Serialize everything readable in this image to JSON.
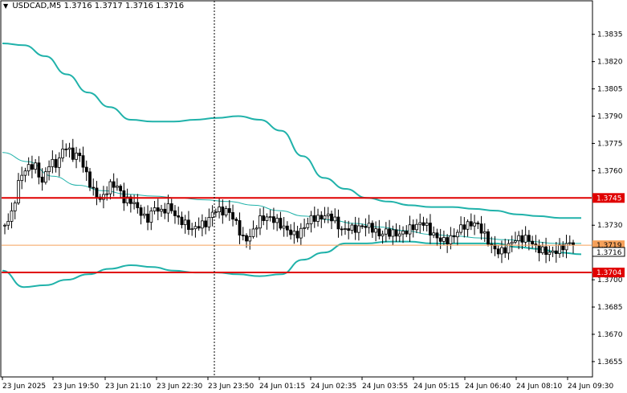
{
  "header": {
    "symbol": "USDCAD,M5",
    "open": "1.3716",
    "high": "1.3717",
    "low": "1.3716",
    "close": "1.3716"
  },
  "colors": {
    "background": "#ffffff",
    "candle": "#000000",
    "bands": "#20b2aa",
    "level": "#e00000",
    "current_price": "#f5a05a",
    "grid_vline": "#000000"
  },
  "chart_data": {
    "type": "candlestick",
    "symbol": "USDCAD",
    "timeframe": "M5",
    "ylim": [
      1.3647,
      1.3853
    ],
    "y_ticks": [
      "1.3835",
      "1.3820",
      "1.3805",
      "1.3790",
      "1.3775",
      "1.3760",
      "1.3745",
      "1.3730",
      "1.3719",
      "1.3716",
      "1.3704",
      "1.3700",
      "1.3685",
      "1.3670",
      "1.3655"
    ],
    "y_tick_values": [
      1.3835,
      1.382,
      1.3805,
      1.379,
      1.3775,
      1.376,
      1.373,
      1.37,
      1.3685,
      1.367,
      1.3655
    ],
    "x_labels": [
      "23 Jun 2025",
      "23 Jun 19:50",
      "23 Jun 21:10",
      "23 Jun 22:30",
      "23 Jun 23:50",
      "24 Jun 01:15",
      "24 Jun 02:35",
      "24 Jun 03:55",
      "24 Jun 05:15",
      "24 Jun 06:40",
      "24 Jun 08:10",
      "24 Jun 09:30"
    ],
    "levels": [
      {
        "price": 1.3745,
        "label": "1.3745"
      },
      {
        "price": 1.3704,
        "label": "1.3704"
      }
    ],
    "current_price": {
      "price": 1.3716,
      "label": "1.3716"
    },
    "marker_price": {
      "price": 1.3719,
      "label": "1.3719"
    },
    "close_path": [
      1.373,
      1.3733,
      1.3752,
      1.376,
      1.3766,
      1.3758,
      1.3768,
      1.3762,
      1.377,
      1.3764,
      1.3768,
      1.376,
      1.3752,
      1.3746,
      1.375,
      1.3747,
      1.374,
      1.3744,
      1.3742,
      1.3737,
      1.3741,
      1.3734,
      1.3736,
      1.3731,
      1.3733,
      1.3732,
      1.3734,
      1.3731,
      1.3735,
      1.3733,
      1.3736,
      1.3733,
      1.3726,
      1.3728,
      1.3732,
      1.373,
      1.3729,
      1.3729,
      1.373,
      1.3729,
      1.3731,
      1.3732,
      1.3729,
      1.3732,
      1.3734,
      1.3731,
      1.3733,
      1.3729,
      1.3727,
      1.3724,
      1.3722,
      1.3728,
      1.373,
      1.3729,
      1.3728,
      1.3726,
      1.3727,
      1.3724,
      1.3725,
      1.3726,
      1.3727,
      1.3728,
      1.3726,
      1.3727,
      1.3725,
      1.3722,
      1.372,
      1.3719,
      1.372,
      1.3718,
      1.3719,
      1.3718,
      1.372,
      1.3719,
      1.3718,
      1.3716,
      1.3716
    ],
    "upper_band": [
      1.383,
      1.3829,
      1.3823,
      1.3813,
      1.3803,
      1.3795,
      1.3788,
      1.3787,
      1.3787,
      1.3788,
      1.3789,
      1.379,
      1.3788,
      1.3782,
      1.3768,
      1.3756,
      1.375,
      1.3745,
      1.3743,
      1.3741,
      1.374,
      1.374,
      1.3739,
      1.3738,
      1.3736,
      1.3735,
      1.3734,
      1.3734
    ],
    "lower_band": [
      1.3705,
      1.3696,
      1.3697,
      1.37,
      1.3703,
      1.3706,
      1.3708,
      1.3707,
      1.3705,
      1.3704,
      1.3704,
      1.3703,
      1.3702,
      1.3703,
      1.3711,
      1.3715,
      1.372,
      1.372,
      1.3721,
      1.3721,
      1.372,
      1.372,
      1.372,
      1.372,
      1.3718,
      1.3717,
      1.3715,
      1.3714
    ],
    "middle_band": [
      1.377,
      1.3765,
      1.3757,
      1.3752,
      1.3749,
      1.3747,
      1.3746,
      1.3745,
      1.3744,
      1.3743,
      1.3741,
      1.3738,
      1.3735,
      1.3733,
      1.3731,
      1.3729,
      1.3727,
      1.3725,
      1.3724,
      1.3723,
      1.3722,
      1.3721,
      1.372,
      1.372
    ]
  }
}
